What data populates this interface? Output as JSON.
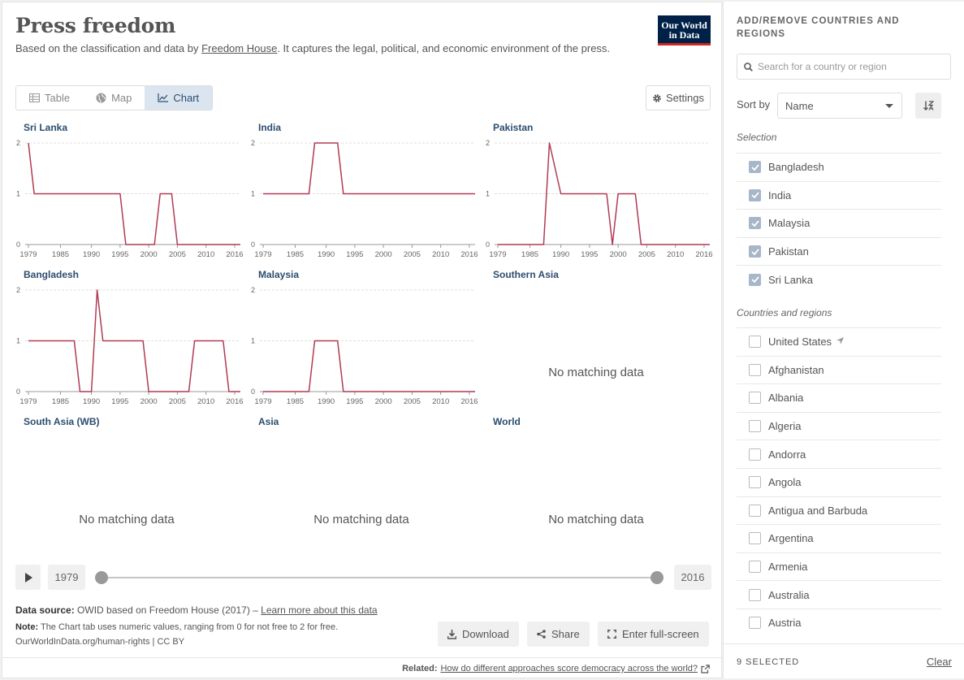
{
  "header": {
    "title": "Press freedom",
    "subtitle_pre": "Based on the classification and data by ",
    "subtitle_link": "Freedom House",
    "subtitle_post": ". It captures the legal, political, and economic environment of the press.",
    "logo_line1": "Our World",
    "logo_line2": "in Data"
  },
  "tabs": [
    {
      "label": "Table",
      "icon": "table-icon"
    },
    {
      "label": "Map",
      "icon": "globe-icon"
    },
    {
      "label": "Chart",
      "icon": "line-chart-icon",
      "active": true
    }
  ],
  "settings_label": "Settings",
  "chart_data": {
    "type": "line",
    "layout": "small-multiples",
    "line_color": "#b13b55",
    "x_tick_labels": [
      "1979",
      "1985",
      "1990",
      "1995",
      "2000",
      "2005",
      "2010",
      "2016"
    ],
    "x_range": [
      1979,
      2016
    ],
    "y_range": [
      0,
      2
    ],
    "y_ticks": [
      "0",
      "1",
      "2"
    ],
    "no_data_text": "No matching data",
    "panels": [
      {
        "name": "Sri Lanka",
        "x": [
          1979,
          1980,
          1995,
          1996,
          1997,
          1998,
          1999,
          2001,
          2002,
          2004,
          2005,
          2016
        ],
        "y": [
          2,
          1,
          1,
          0,
          0,
          0,
          0,
          0,
          1,
          1,
          0,
          0
        ]
      },
      {
        "name": "India",
        "x": [
          1979,
          1987,
          1988,
          1992,
          1993,
          2016
        ],
        "y": [
          1,
          1,
          2,
          2,
          1,
          1
        ]
      },
      {
        "name": "Pakistan",
        "x": [
          1979,
          1987,
          1988,
          1990,
          1998,
          1999,
          2000,
          2003,
          2004,
          2016
        ],
        "y": [
          0,
          0,
          2,
          1,
          1,
          0,
          1,
          1,
          0,
          0
        ]
      },
      {
        "name": "Bangladesh",
        "x": [
          1979,
          1987,
          1988,
          1989,
          1990,
          1991,
          1992,
          1999,
          2000,
          2007,
          2008,
          2013,
          2014,
          2016
        ],
        "y": [
          1,
          1,
          0,
          0,
          0,
          2,
          1,
          1,
          0,
          0,
          1,
          1,
          0,
          0
        ]
      },
      {
        "name": "Malaysia",
        "x": [
          1979,
          1987,
          1988,
          1992,
          1993,
          2016
        ],
        "y": [
          0,
          0,
          1,
          1,
          0,
          0
        ]
      },
      {
        "name": "Southern Asia",
        "x": [],
        "y": []
      },
      {
        "name": "South Asia (WB)",
        "x": [],
        "y": []
      },
      {
        "name": "Asia",
        "x": [],
        "y": []
      },
      {
        "name": "World",
        "x": [],
        "y": []
      }
    ]
  },
  "timeline": {
    "start": "1979",
    "end": "2016"
  },
  "footer": {
    "source_label": "Data source:",
    "source_text": "OWID based on Freedom House (2017) – ",
    "source_link": "Learn more about this data",
    "note_label": "Note:",
    "note_text": "The Chart tab uses numeric values, ranging from 0 for not free to 2 for free.",
    "url": "OurWorldInData.org/human-rights | CC BY",
    "download_label": "Download",
    "share_label": "Share",
    "fullscreen_label": "Enter full-screen",
    "related_label": "Related:",
    "related_link": "How do different approaches score democracy across the world?"
  },
  "sidebar": {
    "heading": "ADD/REMOVE COUNTRIES AND REGIONS",
    "search_placeholder": "Search for a country or region",
    "sort_label": "Sort by",
    "sort_value": "Name",
    "selection_label": "Selection",
    "selected": [
      "Bangladesh",
      "India",
      "Malaysia",
      "Pakistan",
      "Sri Lanka"
    ],
    "countries_label": "Countries and regions",
    "countries": [
      "United States",
      "Afghanistan",
      "Albania",
      "Algeria",
      "Andorra",
      "Angola",
      "Antigua and Barbuda",
      "Argentina",
      "Armenia",
      "Australia",
      "Austria"
    ],
    "selected_count": "9 SELECTED",
    "clear_label": "Clear"
  }
}
